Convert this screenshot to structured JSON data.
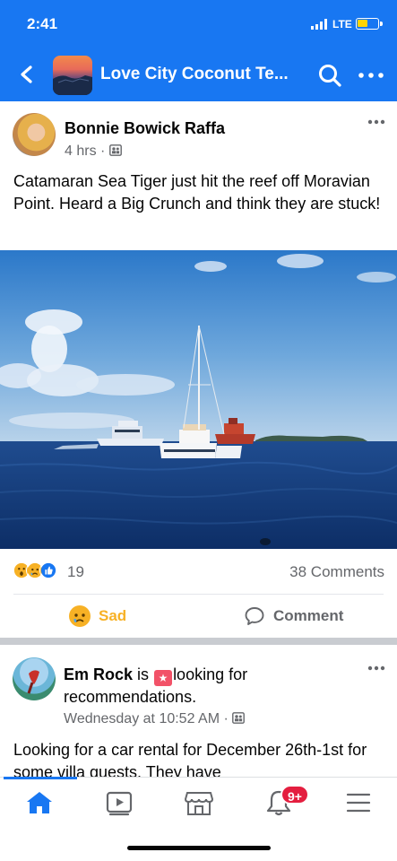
{
  "status_bar": {
    "time": "2:41",
    "network": "LTE",
    "battery_color": "#ffd400"
  },
  "header": {
    "title": "Love City Coconut Te...",
    "back_icon": "chevron-left-icon",
    "search_icon": "search-icon",
    "more_icon": "more-horizontal-icon",
    "accent": "#1877f2"
  },
  "post1": {
    "author": "Bonnie Bowick Raffa",
    "time": "4 hrs",
    "audience_icon": "group-audience-icon",
    "text": "Catamaran Sea Tiger just hit the reef off Moravian Point. Heard a Big Crunch and think they are stuck!",
    "reaction_count": "19",
    "reaction_icons": [
      "wow-reaction-icon",
      "sad-reaction-icon",
      "like-reaction-icon"
    ],
    "comments": "38 Comments",
    "actions": {
      "sad_label": "Sad",
      "comment_label": "Comment"
    }
  },
  "post2": {
    "author": "Em Rock",
    "is_text": "is",
    "activity": "looking for recommendations.",
    "time": "Wednesday at 10:52 AM",
    "text": "Looking for a car rental for December 26th-1st for some villa guests. They have"
  },
  "tabbar": {
    "items": [
      "home-icon",
      "video-icon",
      "marketplace-icon",
      "notifications-icon",
      "menu-icon"
    ],
    "notification_badge": "9+"
  }
}
